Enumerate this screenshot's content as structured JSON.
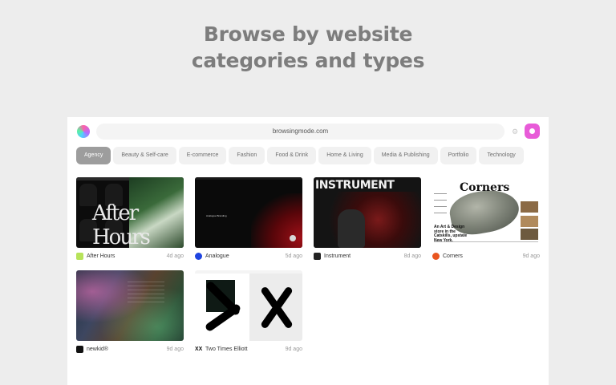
{
  "headline": {
    "line1": "Browse by website",
    "line2": "categories and types"
  },
  "browser": {
    "url": "browsingmode.com",
    "logo_icon": "gradient-blob-icon",
    "settings_icon": "gear-icon",
    "action_icon": "pink-dot-icon",
    "accent": "#e85bd8"
  },
  "categories": [
    {
      "label": "Agency",
      "active": true
    },
    {
      "label": "Beauty & Self-care",
      "active": false
    },
    {
      "label": "E-commerce",
      "active": false
    },
    {
      "label": "Fashion",
      "active": false
    },
    {
      "label": "Food & Drink",
      "active": false
    },
    {
      "label": "Home & Living",
      "active": false
    },
    {
      "label": "Media & Publishing",
      "active": false
    },
    {
      "label": "Portfolio",
      "active": false
    },
    {
      "label": "Technology",
      "active": false
    }
  ],
  "sites": [
    {
      "name": "After Hours",
      "age": "4d ago",
      "favicon_color": "#b7e35a"
    },
    {
      "name": "Analogue",
      "age": "5d ago",
      "favicon_color": "#1f44e0"
    },
    {
      "name": "Instrument",
      "age": "8d ago",
      "favicon_color": "#222222"
    },
    {
      "name": "Corners",
      "age": "9d ago",
      "favicon_color": "#e9551f"
    },
    {
      "name": "newkid®",
      "age": "9d ago",
      "favicon_color": "#111111"
    },
    {
      "name": "Two Times Elliott",
      "age": "9d ago",
      "favicon_color": "#111111"
    }
  ],
  "thumb_text": {
    "afterhours_big": "After Hours",
    "instrument_title": "INSTRUMENT",
    "corners_title": "Corners",
    "corners_caption": "An Art & Design store in the Catskills, upstate New York.",
    "analogue_label": "Analogue Branding"
  }
}
